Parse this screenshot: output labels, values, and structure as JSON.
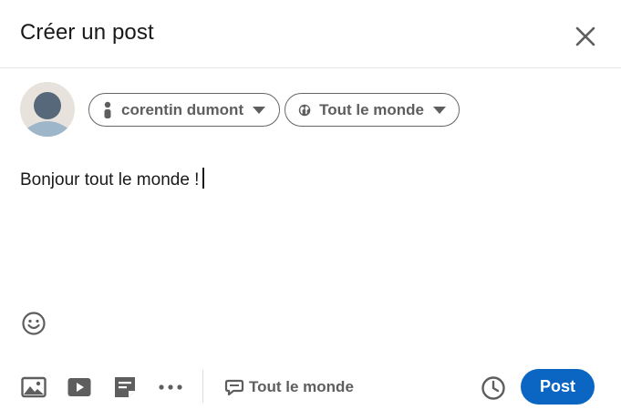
{
  "dialog": {
    "title": "Créer un post",
    "close_icon": "close-icon"
  },
  "author": {
    "name": "corentin dumont",
    "icon": "person-icon"
  },
  "audience": {
    "label": "Tout le monde",
    "icon": "globe-icon"
  },
  "editor": {
    "text": "Bonjour tout le monde !"
  },
  "toolbar": {
    "emoji_icon": "emoji-icon",
    "photo_icon": "image-icon",
    "video_icon": "video-icon",
    "document_icon": "document-icon",
    "more_icon": "more-icon",
    "comment_control_label": "Tout le monde",
    "comment_icon": "comment-icon",
    "schedule_icon": "clock-icon",
    "post_label": "Post"
  },
  "colors": {
    "accent": "#0a66c2",
    "icon": "#5e5e5e",
    "text": "#191919"
  }
}
